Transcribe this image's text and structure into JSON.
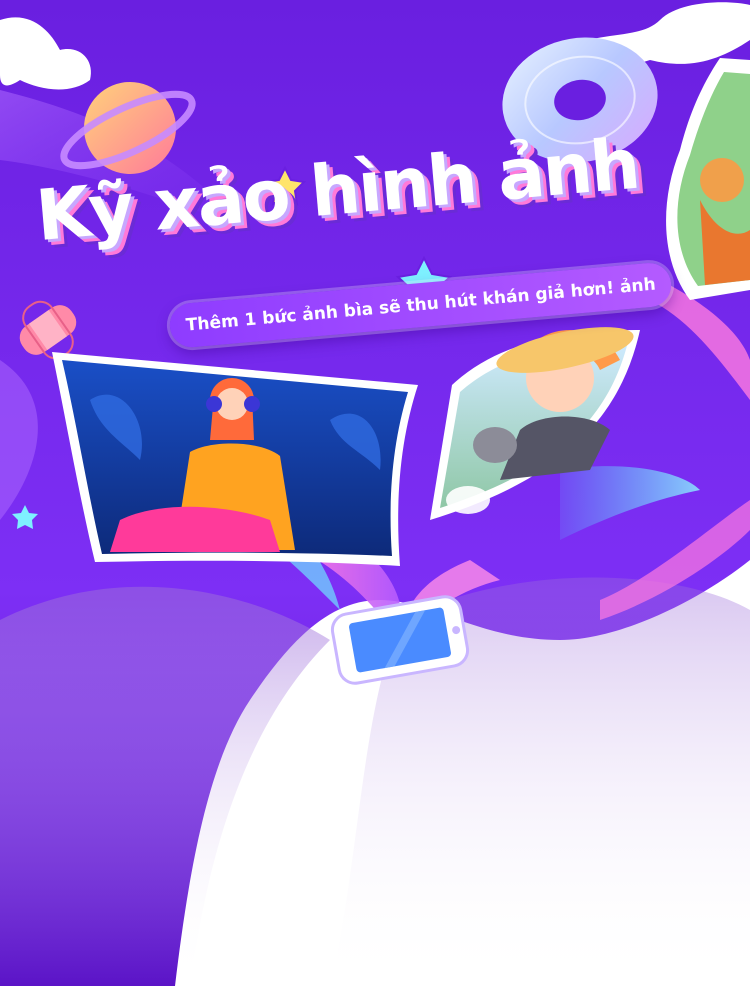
{
  "title": "Kỹ xảo hình ảnh",
  "subtitle": "Thêm 1 bức ảnh bìa sẽ thu hút khán giả hơn! ảnh",
  "colors": {
    "primary_purple": "#7b2ff2",
    "deep_purple": "#5a13c9",
    "pink_accent": "#ff5fc8",
    "cyan_accent": "#4fe0ff",
    "background": "#ffffff"
  },
  "icons": [
    "planet-icon",
    "disc-icon",
    "star-icon",
    "bandage-icon",
    "phone-icon",
    "cloud-icon"
  ]
}
